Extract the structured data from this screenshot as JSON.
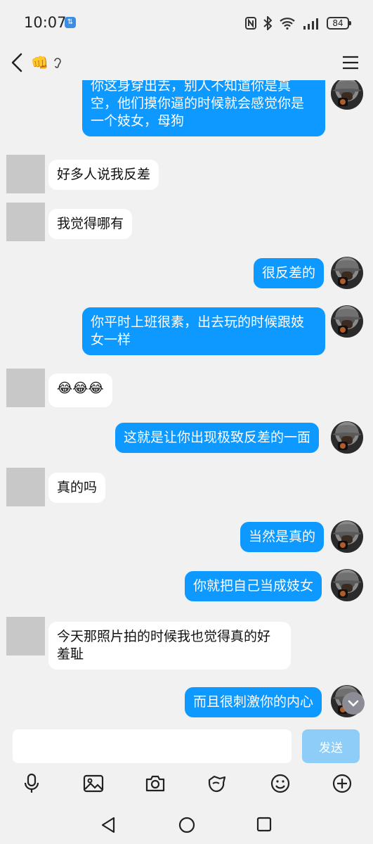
{
  "status_bar": {
    "time": "10:07",
    "battery": "84"
  },
  "header": {
    "title_emoji": "👊",
    "title_extra": ""
  },
  "messages": [
    {
      "side": "out",
      "text": "你这身穿出去，别人不知道你是真空，他们摸你逼的时候就会感觉你是一个妓女，母狗"
    },
    {
      "side": "in",
      "text": "好多人说我反差"
    },
    {
      "side": "in",
      "text": "我觉得哪有"
    },
    {
      "side": "out",
      "text": "很反差的"
    },
    {
      "side": "out",
      "text": "你平时上班很素，出去玩的时候跟妓女一样"
    },
    {
      "side": "in",
      "text": "😂😂😂"
    },
    {
      "side": "out",
      "text": "这就是让你出现极致反差的一面"
    },
    {
      "side": "in",
      "text": "真的吗"
    },
    {
      "side": "out",
      "text": "当然是真的"
    },
    {
      "side": "out",
      "text": "你就把自己当成妓女"
    },
    {
      "side": "in",
      "text": "今天那照片拍的时候我也觉得真的好羞耻"
    },
    {
      "side": "out",
      "text": "而且很刺激你的内心"
    }
  ],
  "composer": {
    "input_value": "",
    "send_label": "发送"
  },
  "toolbar": {
    "icons": [
      "microphone-icon",
      "image-icon",
      "camera-icon",
      "red-packet-icon",
      "emoji-icon",
      "plus-icon"
    ]
  },
  "colors": {
    "out_bubble": "#0d99ff",
    "in_bubble": "#ffffff",
    "background": "#f1f1f1",
    "send_button": "#8ecdf7"
  }
}
